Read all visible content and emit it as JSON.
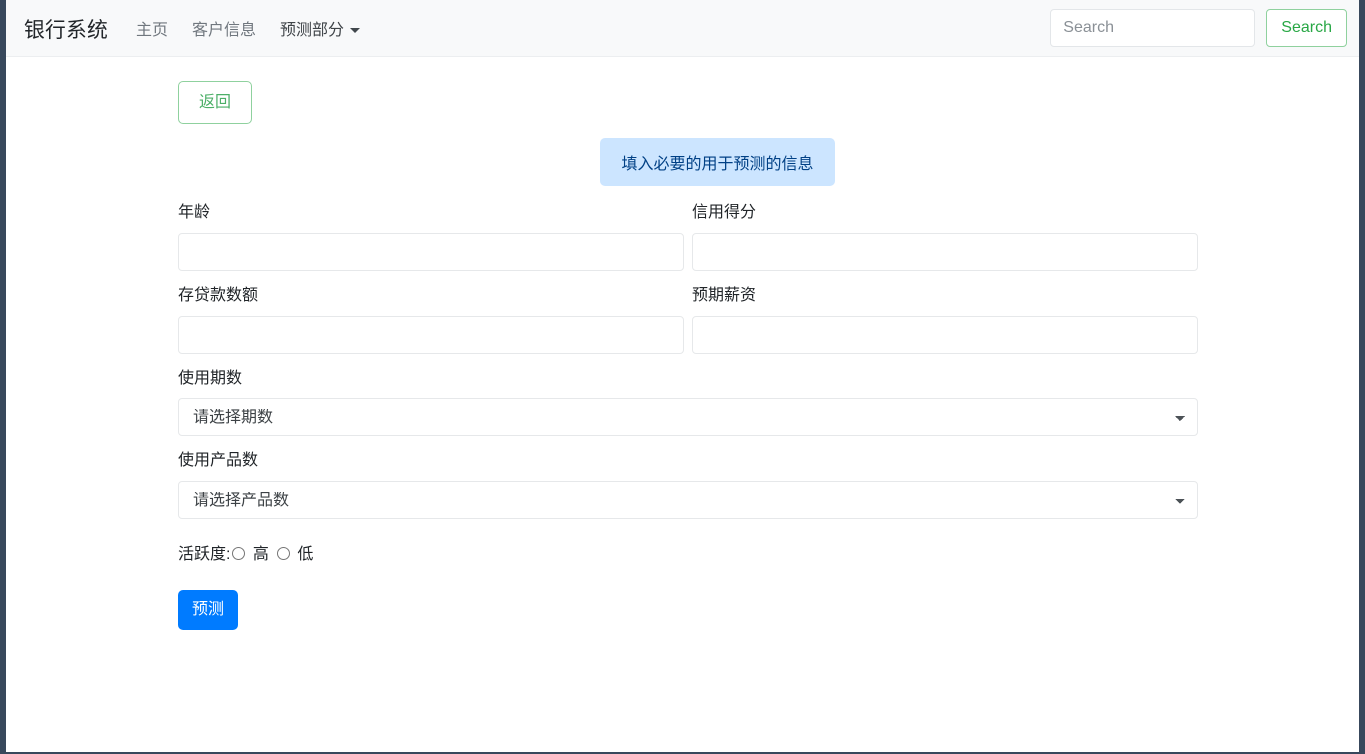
{
  "window": {
    "frame_color": "#38485c",
    "page_background": "#ffffff"
  },
  "navbar": {
    "brand": "银行系统",
    "background": "#f8f9fa",
    "links": [
      {
        "label": "主页",
        "active": false
      },
      {
        "label": "客户信息",
        "active": false
      }
    ],
    "dropdown": {
      "label": "预测部分",
      "caret_icon": "caret-down-icon"
    },
    "search": {
      "placeholder": "Search",
      "value": "",
      "button_label": "Search",
      "button_color": "#28a745"
    }
  },
  "main": {
    "back_button": {
      "label": "返回",
      "color": "#28a745"
    },
    "info_banner": {
      "text": "填入必要的用于预测的信息",
      "background": "#cce5ff",
      "text_color": "#004085"
    },
    "fields": {
      "age": {
        "label": "年龄",
        "value": "",
        "placeholder": ""
      },
      "credit_score": {
        "label": "信用得分",
        "value": "",
        "placeholder": ""
      },
      "balance": {
        "label": "存贷款数额",
        "value": "",
        "placeholder": ""
      },
      "estimated_salary": {
        "label": "预期薪资",
        "value": "",
        "placeholder": ""
      },
      "tenure": {
        "label": "使用期数",
        "selected": "请选择期数",
        "options": [
          "请选择期数"
        ]
      },
      "num_products": {
        "label": "使用产品数",
        "selected": "请选择产品数",
        "options": [
          "请选择产品数"
        ]
      },
      "activity": {
        "label": "活跃度:",
        "options": [
          {
            "label": "高",
            "checked": false
          },
          {
            "label": "低",
            "checked": false
          }
        ]
      }
    },
    "predict_button": {
      "label": "预测",
      "color": "#007bff"
    }
  }
}
